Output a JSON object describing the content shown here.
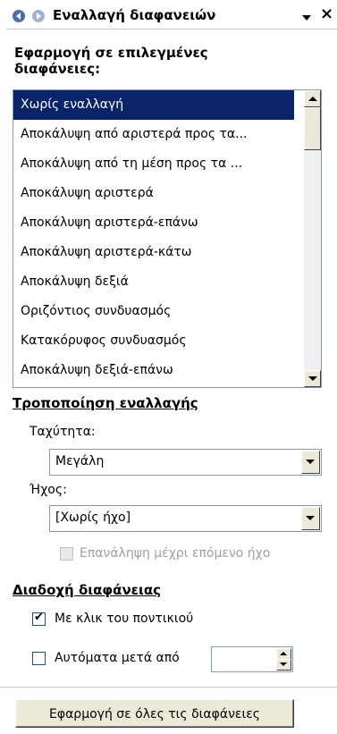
{
  "header": {
    "title": "Εναλλαγή διαφανειών",
    "back_icon": "back-arrow-icon",
    "forward_icon": "forward-arrow-icon",
    "menu_icon": "dropdown-triangle-icon",
    "close_label": "×"
  },
  "apply_section": {
    "heading": "Εφαρμογή σε επιλεγμένες διαφάνειες:",
    "selected_index": 0,
    "items": [
      "Χωρίς εναλλαγή",
      "Αποκάλυψη από αριστερά προς τα...",
      "Αποκάλυψη από τη μέση προς τα ...",
      "Αποκάλυψη αριστερά",
      "Αποκάλυψη αριστερά-επάνω",
      "Αποκάλυψη αριστερά-κάτω",
      "Αποκάλυψη δεξιά",
      "Οριζόντιος συνδυασμός",
      "Κατακόρυφος συνδυασμός",
      "Αποκάλυψη δεξιά-επάνω"
    ]
  },
  "modify_section": {
    "heading": "Τροποποίηση εναλλαγής",
    "speed_label": "Ταχύτητα:",
    "speed_value": "Μεγάλη",
    "sound_label": "Ήχος:",
    "sound_value": "[Χωρίς ήχο]",
    "loop_label": "Επανάληψη μέχρι επόμενο ήχο",
    "loop_checked": false,
    "loop_enabled": false
  },
  "advance_section": {
    "heading": "Διαδοχή διαφάνειας",
    "on_click_label": "Με κλικ του ποντικιού",
    "on_click_checked": true,
    "auto_label": "Αυτόματα μετά από",
    "auto_checked": false,
    "auto_value": ""
  },
  "footer": {
    "apply_all_label": "Εφαρμογή σε όλες τις διαφάνειες"
  },
  "colors": {
    "selection": "#0a246a",
    "control_face": "#ece9d8",
    "border": "#7f9db9"
  }
}
